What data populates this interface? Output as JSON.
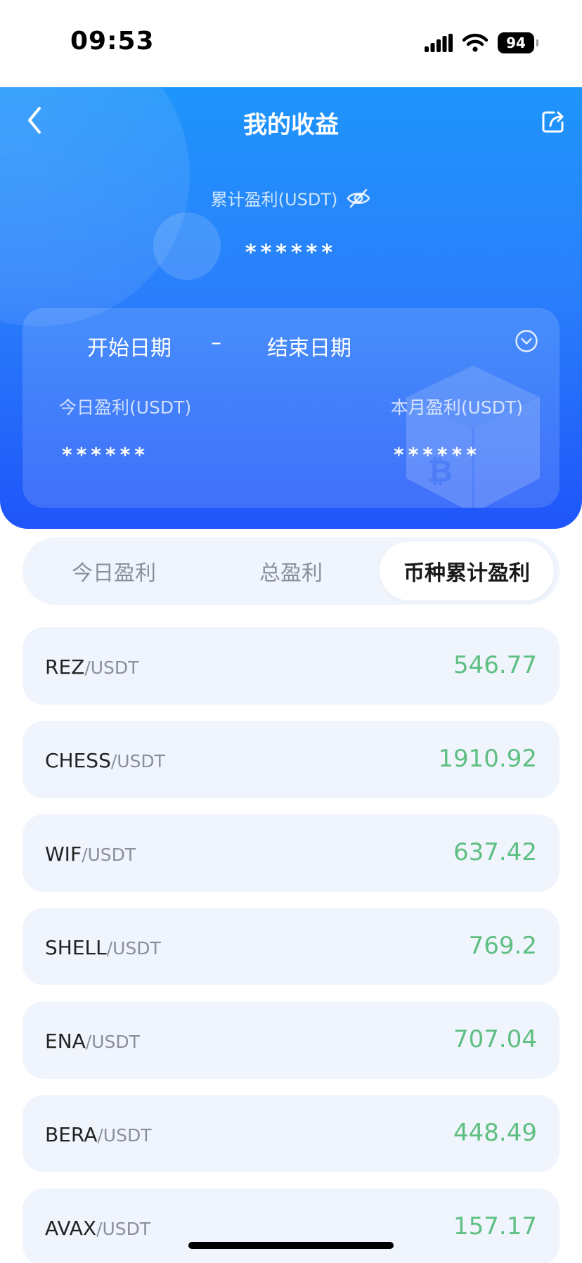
{
  "status_bar": {
    "time": "09:53",
    "battery": "94"
  },
  "header": {
    "title": "我的收益",
    "cumulative_label": "累计盈利(USDT)",
    "cumulative_value": "******"
  },
  "card": {
    "start_date": "开始日期",
    "separator": "–",
    "end_date": "结束日期",
    "today_label": "今日盈利(USDT)",
    "today_value": "******",
    "month_label": "本月盈利(USDT)",
    "month_value": "******"
  },
  "tabs": [
    {
      "label": "今日盈利",
      "active": false
    },
    {
      "label": "总盈利",
      "active": false
    },
    {
      "label": "币种累计盈利",
      "active": true
    }
  ],
  "rows": [
    {
      "base": "REZ",
      "quote": "/USDT",
      "profit": "546.77"
    },
    {
      "base": "CHESS",
      "quote": "/USDT",
      "profit": "1910.92"
    },
    {
      "base": "WIF",
      "quote": "/USDT",
      "profit": "637.42"
    },
    {
      "base": "SHELL",
      "quote": "/USDT",
      "profit": "769.2"
    },
    {
      "base": "ENA",
      "quote": "/USDT",
      "profit": "707.04"
    },
    {
      "base": "BERA",
      "quote": "/USDT",
      "profit": "448.49"
    },
    {
      "base": "AVAX",
      "quote": "/USDT",
      "profit": "157.17"
    }
  ],
  "icons": {
    "back": "chevron-left-icon",
    "share": "share-icon",
    "visibility": "eye-off-icon",
    "dropdown": "chevron-down-circle-icon"
  },
  "colors": {
    "hero_top": "#1e95fb",
    "hero_bottom": "#1f55fa",
    "profit": "#5ebf82",
    "row_bg": "#f0f4fc"
  }
}
